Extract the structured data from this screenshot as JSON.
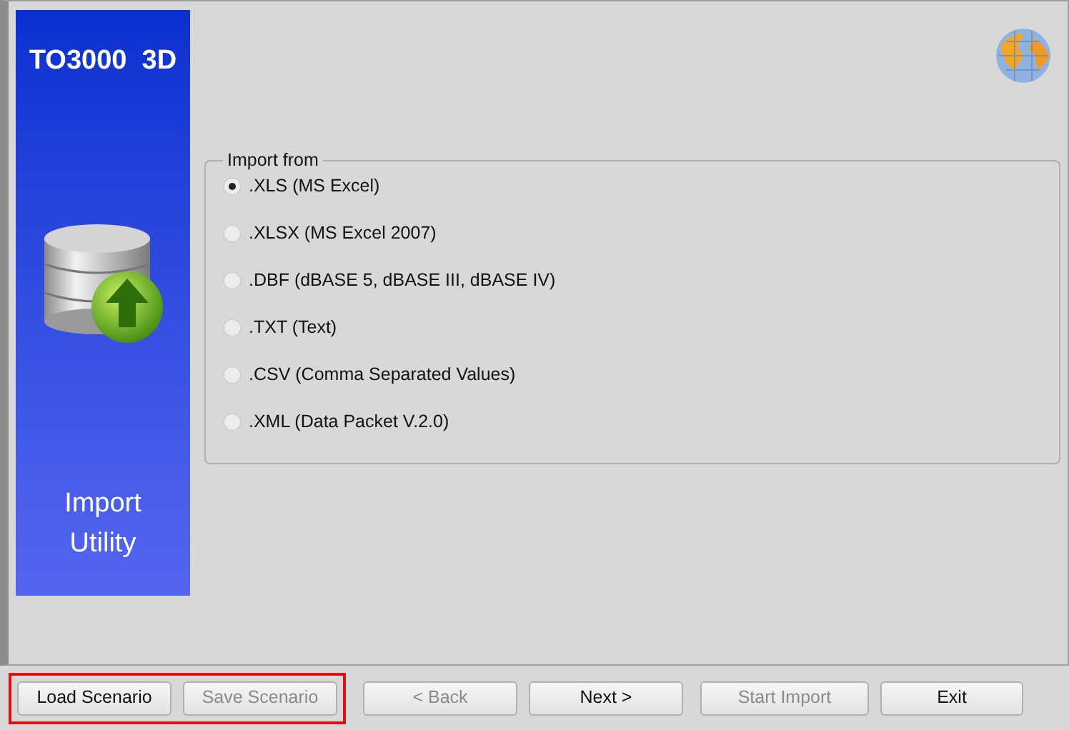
{
  "banner": {
    "title": "TO3000  3D",
    "subtitle": "Import Utility"
  },
  "import_group": {
    "legend": "Import from",
    "options": [
      {
        "label": ".XLS (MS Excel)",
        "selected": true
      },
      {
        "label": ".XLSX (MS Excel 2007)",
        "selected": false
      },
      {
        "label": ".DBF (dBASE 5, dBASE III, dBASE IV)",
        "selected": false
      },
      {
        "label": ".TXT (Text)",
        "selected": false
      },
      {
        "label": ".CSV (Comma Separated Values)",
        "selected": false
      },
      {
        "label": ".XML (Data Packet V.2.0)",
        "selected": false
      }
    ]
  },
  "button_groups": [
    {
      "highlighted": true,
      "buttons": [
        {
          "label": "Load Scenario",
          "disabled": false
        },
        {
          "label": "Save Scenario",
          "disabled": true
        }
      ]
    },
    {
      "highlighted": false,
      "buttons": [
        {
          "label": "< Back",
          "disabled": true
        },
        {
          "label": "Next >",
          "disabled": false
        }
      ]
    },
    {
      "highlighted": false,
      "buttons": [
        {
          "label": "Start Import",
          "disabled": true
        },
        {
          "label": "Exit",
          "disabled": false
        }
      ]
    }
  ]
}
